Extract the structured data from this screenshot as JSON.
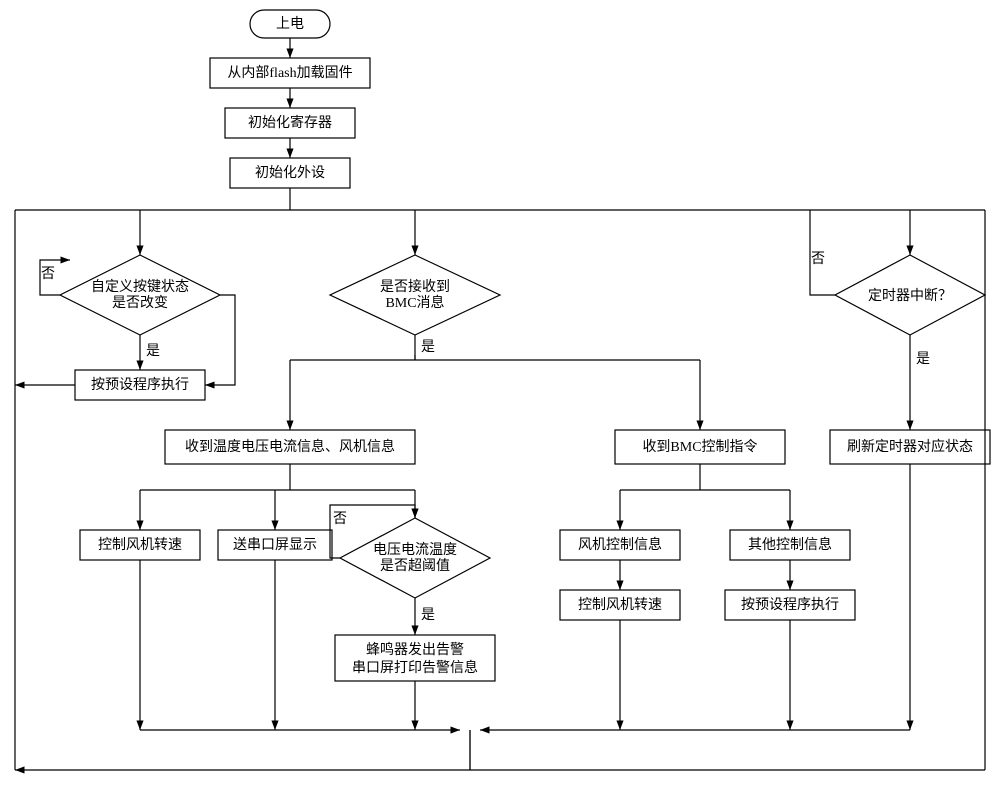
{
  "chart_data": {
    "type": "flowchart",
    "title": "",
    "nodes": [
      {
        "id": "start",
        "shape": "terminator",
        "label": "上电"
      },
      {
        "id": "load",
        "shape": "process",
        "label": "从内部flash加载固件"
      },
      {
        "id": "initReg",
        "shape": "process",
        "label": "初始化寄存器"
      },
      {
        "id": "initPeri",
        "shape": "process",
        "label": "初始化外设"
      },
      {
        "id": "dKey",
        "shape": "decision",
        "l1": "自定义按键状态",
        "l2": "是否改变"
      },
      {
        "id": "dBmc",
        "shape": "decision",
        "l1": "是否接收到",
        "l2": "BMC消息"
      },
      {
        "id": "dTimer",
        "shape": "decision",
        "l1": "定时器中断？",
        "l2": ""
      },
      {
        "id": "execKey",
        "shape": "process",
        "label": "按预设程序执行"
      },
      {
        "id": "recvTemp",
        "shape": "process",
        "label": "收到温度电压电流信息、风机信息"
      },
      {
        "id": "recvBmc",
        "shape": "process",
        "label": "收到BMC控制指令"
      },
      {
        "id": "refresh",
        "shape": "process",
        "label": "刷新定时器对应状态"
      },
      {
        "id": "fanSpeed1",
        "shape": "process",
        "label": "控制风机转速"
      },
      {
        "id": "sendLcd",
        "shape": "process",
        "label": "送串口屏显示"
      },
      {
        "id": "dThresh",
        "shape": "decision",
        "l1": "电压电流温度",
        "l2": "是否超阈值"
      },
      {
        "id": "fanInfo",
        "shape": "process",
        "label": "风机控制信息"
      },
      {
        "id": "otherInfo",
        "shape": "process",
        "label": "其他控制信息"
      },
      {
        "id": "fanSpeed2",
        "shape": "process",
        "label": "控制风机转速"
      },
      {
        "id": "execOther",
        "shape": "process",
        "label": "按预设程序执行"
      },
      {
        "id": "alarm",
        "shape": "process",
        "l1": "蜂鸣器发出告警",
        "l2": "串口屏打印告警信息"
      }
    ],
    "yesno": {
      "yes": "是",
      "no": "否"
    }
  },
  "labels": {
    "start": "上电",
    "load": "从内部flash加载固件",
    "initReg": "初始化寄存器",
    "initPeri": "初始化外设",
    "dKey1": "自定义按键状态",
    "dKey2": "是否改变",
    "dBmc1": "是否接收到",
    "dBmc2": "BMC消息",
    "dTimer": "定时器中断？",
    "execKey": "按预设程序执行",
    "recvTemp": "收到温度电压电流信息、风机信息",
    "recvBmc": "收到BMC控制指令",
    "refresh": "刷新定时器对应状态",
    "fanSpeed1": "控制风机转速",
    "sendLcd": "送串口屏显示",
    "dThresh1": "电压电流温度",
    "dThresh2": "是否超阈值",
    "fanInfo": "风机控制信息",
    "otherInfo": "其他控制信息",
    "fanSpeed2": "控制风机转速",
    "execOther": "按预设程序执行",
    "alarm1": "蜂鸣器发出告警",
    "alarm2": "串口屏打印告警信息",
    "yes": "是",
    "no": "否"
  }
}
